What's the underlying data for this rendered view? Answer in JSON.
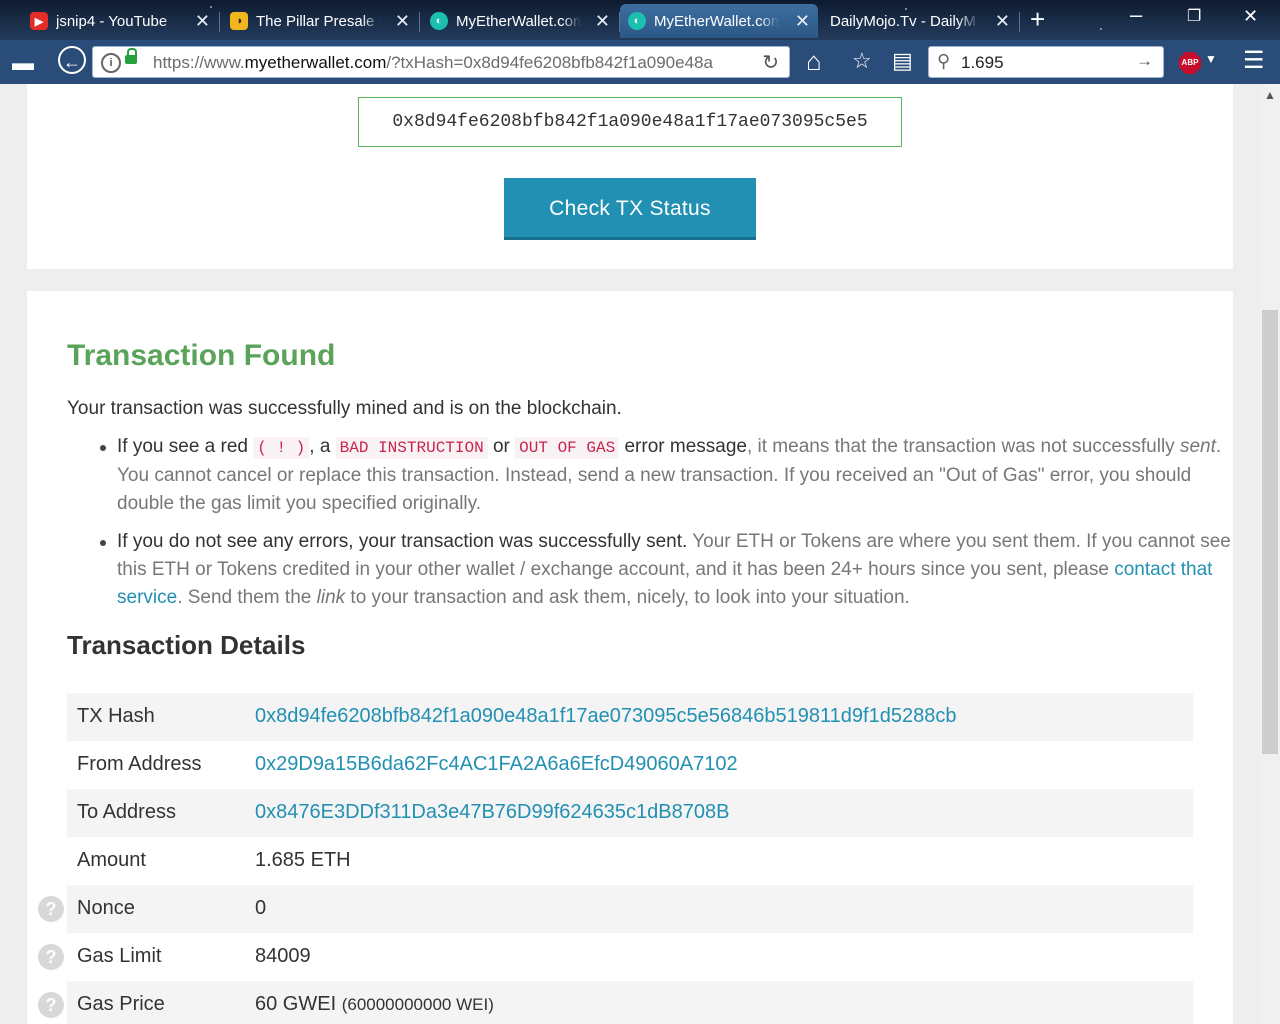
{
  "browser": {
    "tabs": [
      {
        "label": "jsnip4 - YouTube",
        "favicon": "youtube-icon",
        "color": "#e52d27"
      },
      {
        "label": "The Pillar Presale S",
        "favicon": "pillar-icon",
        "color": "#f2b51b"
      },
      {
        "label": "MyEtherWallet.com",
        "favicon": "myetherwallet-icon",
        "color": "#1bbfb0"
      },
      {
        "label": "MyEtherWallet.com",
        "favicon": "myetherwallet-icon",
        "color": "#1bbfb0"
      },
      {
        "label": "DailyMojo.Tv - DailyM",
        "favicon": "",
        "color": ""
      }
    ],
    "active_tab": 3,
    "url_prefix": "https://www.",
    "url_domain": "myetherwallet.com",
    "url_rest": "/?txHash=0x8d94fe6208bfb842f1a090e48a",
    "search_value": "1.695",
    "abp_label": "ABP"
  },
  "form": {
    "hash_value": "0x8d94fe6208bfb842f1a090e48a1f17ae073095c5e5",
    "check_button": "Check TX Status"
  },
  "result": {
    "title": "Transaction Found",
    "lead": "Your transaction was successfully mined and is on the blockchain.",
    "note1": {
      "p1": "If you see a red",
      "c1": "( ! )",
      "p2": ", a",
      "c2": "BAD INSTRUCTION",
      "p3": "or",
      "c3": "OUT OF GAS",
      "p4": "error message",
      "p5": ", it means that the transaction was not successfully",
      "em": "sent",
      "p6": ". You cannot cancel or replace this transaction. Instead, send a new transaction. If you received an \"Out of Gas\" error, you should double the gas limit you specified originally."
    },
    "note2": {
      "p1": "If you do not see any errors, your transaction was successfully sent.",
      "p2": "Your ETH or Tokens are where you sent them. If you cannot see this ETH or Tokens credited in your other wallet / exchange account, and it has been 24+ hours since you sent, please",
      "link": "contact that service",
      "p3": ". Send them the",
      "em": "link",
      "p4": "to your transaction and ask them, nicely, to look into your situation."
    }
  },
  "details": {
    "title": "Transaction Details",
    "rows": [
      {
        "key": "TX Hash",
        "value": "0x8d94fe6208bfb842f1a090e48a1f17ae073095c5e56846b519811d9f1d5288cb"
      },
      {
        "key": "From Address",
        "value": "0x29D9a15B6da62Fc4AC1FA2A6a6EfcD49060A7102"
      },
      {
        "key": "To Address",
        "value": "0x8476E3DDf311Da3e47B76D99f624635c1dB8708B"
      },
      {
        "key": "Amount",
        "value": "1.685 ETH"
      },
      {
        "key": "Nonce",
        "value": "0"
      },
      {
        "key": "Gas Limit",
        "value": "84009"
      },
      {
        "key": "Gas Price",
        "value": "60 GWEI",
        "sub": "(60000000000 WEI)"
      }
    ],
    "help_glyph": "?"
  }
}
